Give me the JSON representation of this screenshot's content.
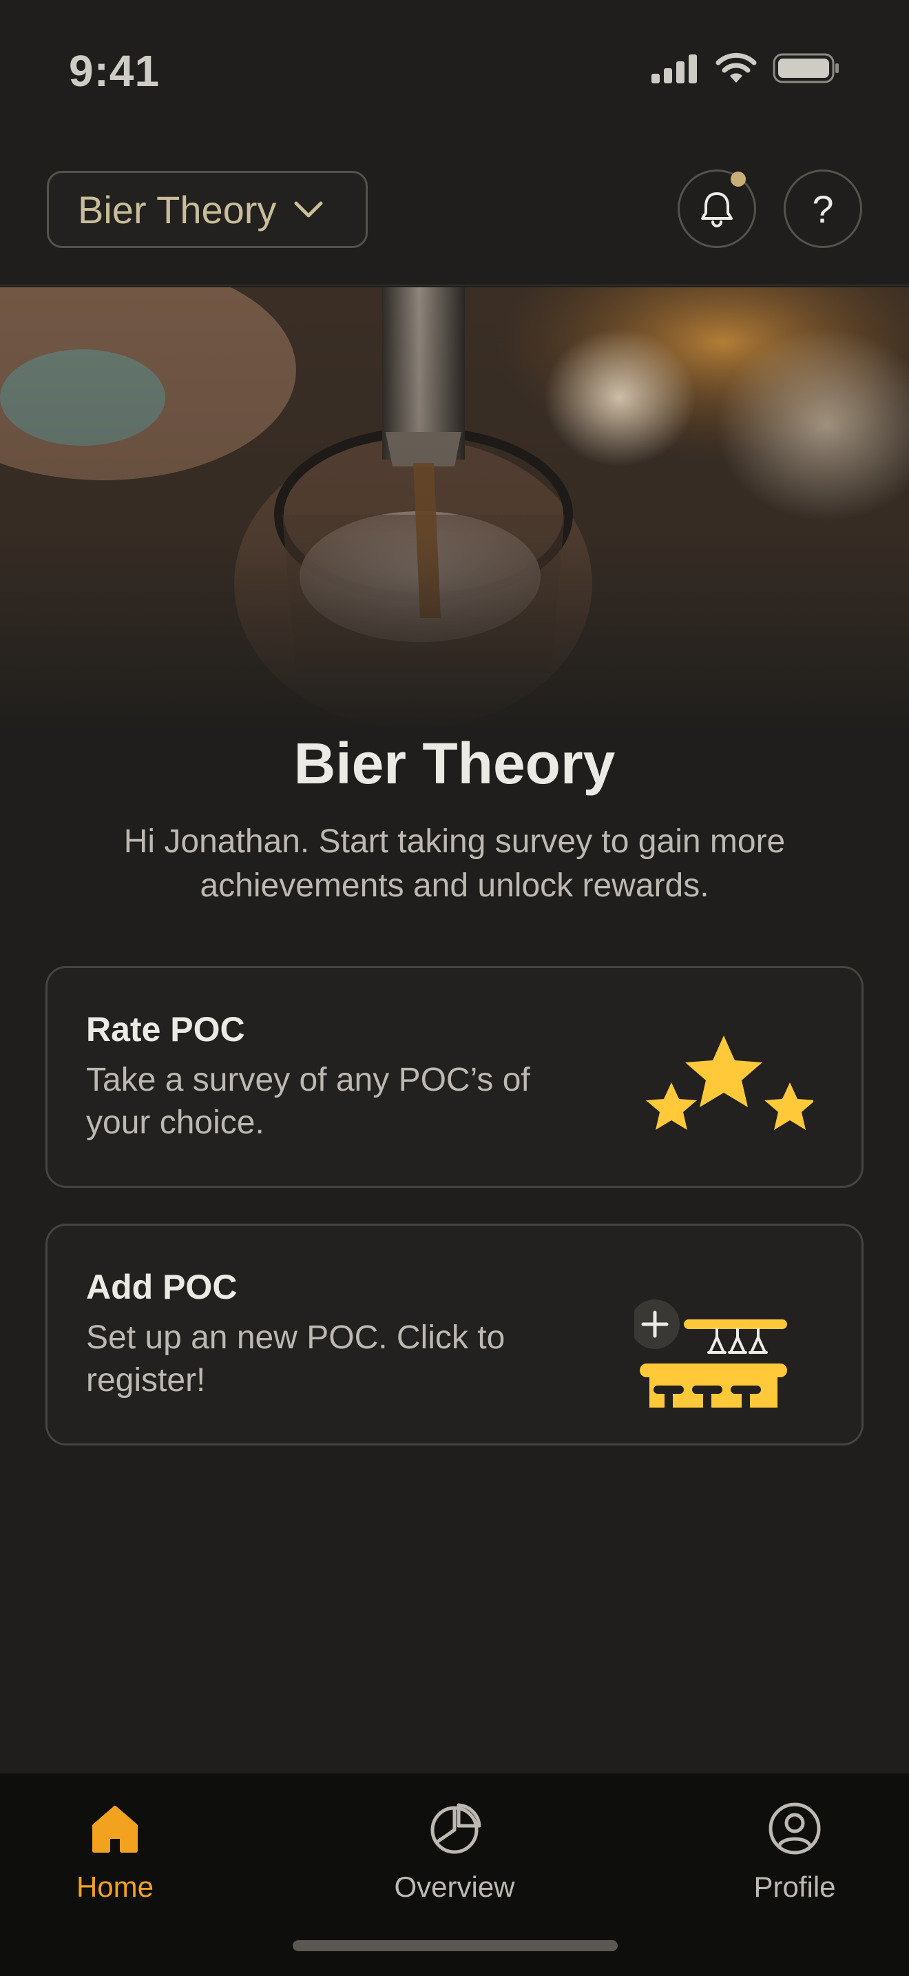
{
  "status_bar": {
    "time": "9:41",
    "icons": [
      "cellular-signal-icon",
      "wifi-icon",
      "battery-icon"
    ]
  },
  "header": {
    "outlet_name": "Bier Theory",
    "notification_indicator": true,
    "help_label": "?"
  },
  "hero": {
    "image": "beer-tap-pouring-photo"
  },
  "main": {
    "title": "Bier Theory",
    "subtitle": "Hi Jonathan. Start taking survey to gain more achievements and unlock rewards."
  },
  "cards": [
    {
      "title": "Rate POC",
      "description": "Take a survey of any POC’s of your choice.",
      "icon": "three-stars-icon"
    },
    {
      "title": "Add POC",
      "description": "Set up an new POC. Click to register!",
      "icon": "bar-counter-add-icon"
    }
  ],
  "nav": {
    "items": [
      {
        "label": "Home",
        "icon": "home-icon",
        "active": true
      },
      {
        "label": "Overview",
        "icon": "pie-chart-icon",
        "active": false
      },
      {
        "label": "Profile",
        "icon": "user-circle-icon",
        "active": false
      }
    ]
  },
  "colors": {
    "accent": "#F3A21F",
    "star": "#FFC93A",
    "background": "#1F1E1C",
    "nav_background": "#0E0E0D"
  }
}
